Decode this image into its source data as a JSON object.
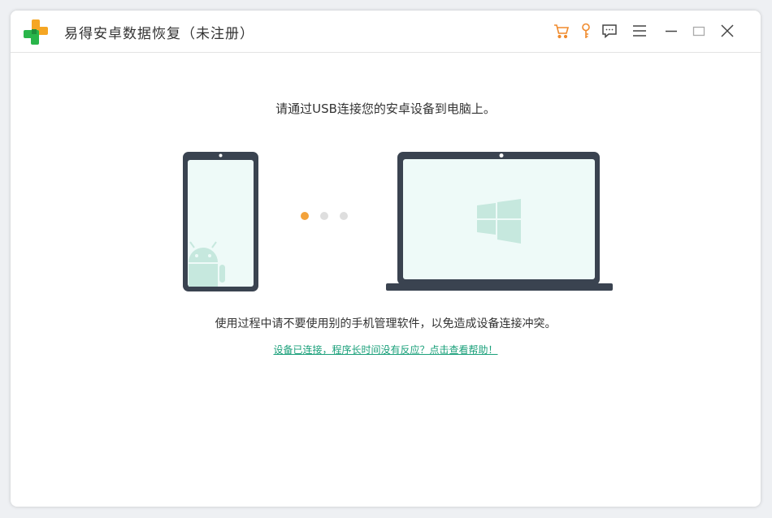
{
  "app": {
    "title": "易得安卓数据恢复（未注册）"
  },
  "titlebar": {
    "icons": [
      "cart-icon",
      "key-icon",
      "feedback-icon",
      "menu-icon",
      "minimize-icon",
      "maximize-icon",
      "close-icon"
    ],
    "accent_color": "#f08a2c"
  },
  "main": {
    "instruction": "请通过USB连接您的安卓设备到电脑上。",
    "note": "使用过程中请不要使用别的手机管理软件，以免造成设备连接冲突。",
    "help_link": "设备已连接，程序长时间没有反应？点击查看帮助！"
  },
  "illustration": {
    "device_color": "#3a4350",
    "screen_color": "#eefaf8",
    "icon_color": "#c6e8de",
    "dot_active_color": "#f3a23a",
    "dot_inactive_color": "#dedede"
  }
}
